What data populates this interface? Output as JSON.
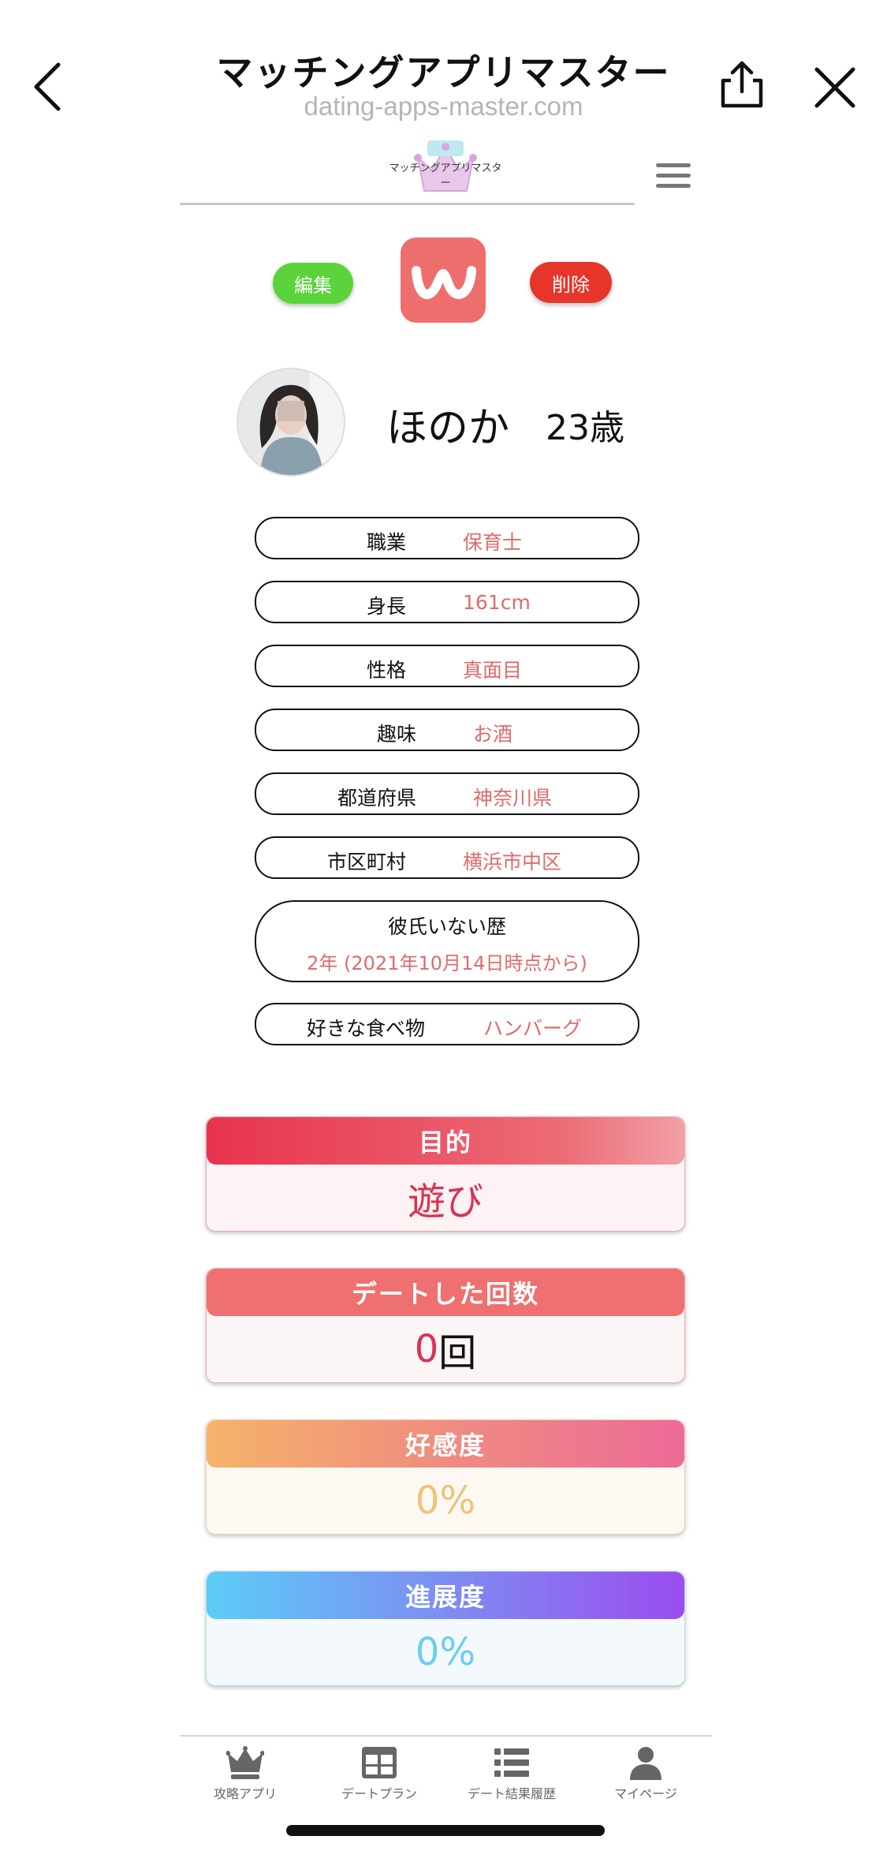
{
  "browser": {
    "title": "マッチングアプリマスター",
    "url": "dating-apps-master.com"
  },
  "header": {
    "logo_text": "マッチングアプリマスター"
  },
  "actions": {
    "edit_label": "編集",
    "delete_label": "削除"
  },
  "profile": {
    "name": "ほのか",
    "age": "23歳"
  },
  "info_rows": [
    {
      "label": "職業",
      "value": "保育士"
    },
    {
      "label": "身長",
      "value": "161cm"
    },
    {
      "label": "性格",
      "value": "真面目"
    },
    {
      "label": "趣味",
      "value": "お酒"
    },
    {
      "label": "都道府県",
      "value": "神奈川県"
    },
    {
      "label": "市区町村",
      "value": "横浜市中区"
    },
    {
      "label": "彼氏いない歴",
      "value": "2年 (2021年10月14日時点から)"
    },
    {
      "label": "好きな食べ物",
      "value": "ハンバーグ"
    }
  ],
  "cards": {
    "purpose": {
      "title": "目的",
      "value": "遊び"
    },
    "date_count": {
      "title": "デートした回数",
      "count": "0",
      "unit": "回"
    },
    "affinity": {
      "title": "好感度",
      "value": "0%"
    },
    "progress": {
      "title": "進展度",
      "value": "0%"
    }
  },
  "tabbar": {
    "items": [
      {
        "label": "攻略アプリ",
        "icon": "crown-icon"
      },
      {
        "label": "デートプラン",
        "icon": "grid-icon"
      },
      {
        "label": "デート結果履歴",
        "icon": "list-icon"
      },
      {
        "label": "マイページ",
        "icon": "person-icon"
      }
    ]
  },
  "colors": {
    "accent_text": "#e06a6a",
    "edit_button": "#5ad43a",
    "delete_button": "#e8352a",
    "app_icon": "#ee6e6e"
  }
}
